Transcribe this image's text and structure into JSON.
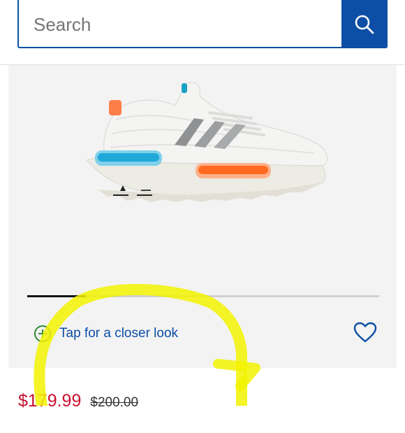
{
  "search": {
    "placeholder": "Search",
    "button_icon": "search-icon"
  },
  "product": {
    "image_alt": "white sneaker with blue and orange heel pods",
    "carousel": {
      "current_slide": 1,
      "total_slides": 6
    },
    "closer_look_label": "Tap for a closer look",
    "closer_look_icon": "plus-circle-icon",
    "wishlist_icon": "heart-icon"
  },
  "price": {
    "sale": "$179.99",
    "original": "$200.00"
  },
  "colors": {
    "brand_blue": "#0d4ea6",
    "sale_red": "#c8102e",
    "highlight_yellow": "#f2f200",
    "plus_green": "#2e8b2e"
  }
}
